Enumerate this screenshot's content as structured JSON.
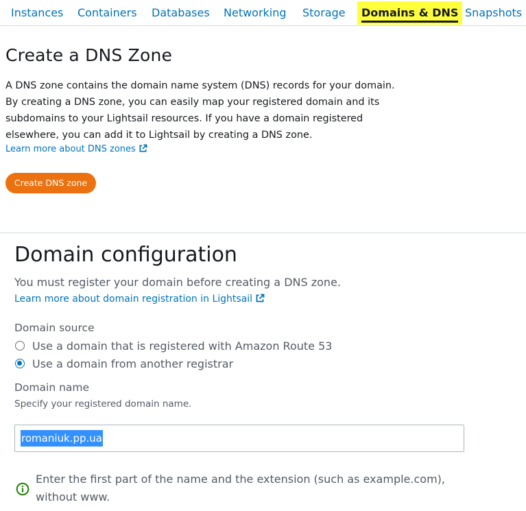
{
  "nav": {
    "tabs": [
      {
        "label": "Instances",
        "active": false
      },
      {
        "label": "Containers",
        "active": false
      },
      {
        "label": "Databases",
        "active": false
      },
      {
        "label": "Networking",
        "active": false
      },
      {
        "label": "Storage",
        "active": false
      },
      {
        "label": "Domains & DNS",
        "active": true
      },
      {
        "label": "Snapshots",
        "active": false
      }
    ]
  },
  "dns_zone": {
    "title": "Create a DNS Zone",
    "description": "A DNS zone contains the domain name system (DNS) records for your domain. By creating a DNS zone, you can easily map your registered domain and its subdomains to your Lightsail resources. If you have a domain registered elsewhere, you can add it to Lightsail by creating a DNS zone.",
    "learn_more_link": "Learn more about DNS zones",
    "create_button": "Create DNS zone"
  },
  "domain_config": {
    "title": "Domain configuration",
    "description": "You must register your domain before creating a DNS zone.",
    "learn_more_link": "Learn more about domain registration in Lightsail",
    "source_label": "Domain source",
    "source_options": [
      {
        "label": "Use a domain that is registered with Amazon Route 53",
        "selected": false
      },
      {
        "label": "Use a domain from another registrar",
        "selected": true
      }
    ],
    "name_label": "Domain name",
    "name_hint": "Specify your registered domain name.",
    "name_value": "romaniuk.pp.ua",
    "info_text": "Enter the first part of the name and the extension (such as example.com), without www."
  },
  "colors": {
    "link": "#0073bb",
    "primary_button": "#ec7211",
    "highlight": "#ffff3c",
    "selection": "#3390ff",
    "info_icon": "#1d8102"
  },
  "icons": {
    "external_link": "external-link-icon",
    "info": "info-icon"
  }
}
